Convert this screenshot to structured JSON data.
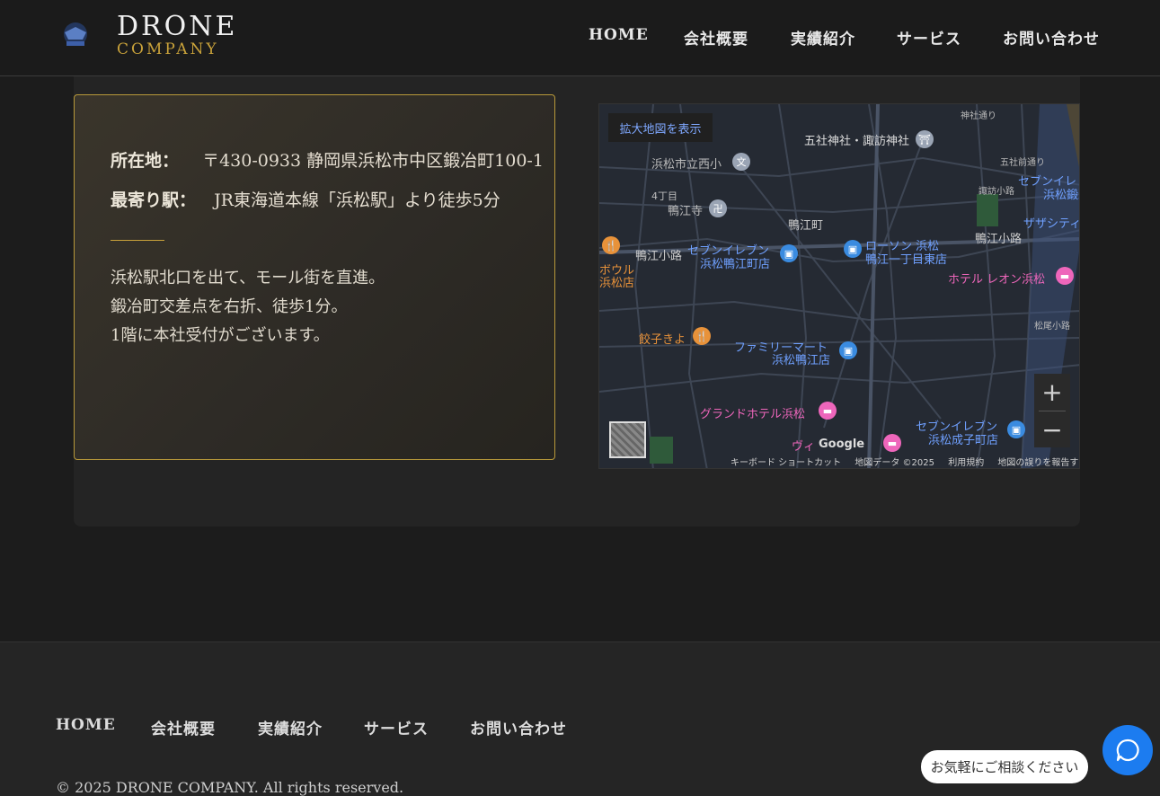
{
  "brand": {
    "title": "DRONE",
    "subtitle": "COMPANY",
    "accent": "#c9a23a"
  },
  "nav": [
    "HOME",
    "会社概要",
    "実績紹介",
    "サービス",
    "お問い合わせ"
  ],
  "access": {
    "address_label": "所在地：",
    "address_value": "〒430-0933 静岡県浜松市中区鍛冶町100-1",
    "station_label": "最寄り駅：",
    "station_value": "JR東海道本線「浜松駅」より徒歩5分",
    "directions": [
      "浜松駅北口を出て、モール街を直進。",
      "鍛冶町交差点を右折、徒歩1分。",
      "1階に本社受付がございます。"
    ]
  },
  "map": {
    "open_larger": "拡大地図を表示",
    "zoom_in": "+",
    "zoom_out": "−",
    "footer": [
      "キーボード ショートカット",
      "地図データ ©2025",
      "利用規約",
      "地図の誤りを報告する"
    ],
    "labels": [
      "五社神社・諏訪神社",
      "浜松市立西小",
      "4丁目",
      "鴨江寺",
      "鴨江町",
      "鴨江小路",
      "セブンイレブン",
      "浜松鴨江町店",
      "ローソン 浜松",
      "鴨江一丁目東店",
      "ボウル",
      "浜松店",
      "ホテル レオン浜松",
      "餃子きよ",
      "ファミリーマート",
      "浜松鴨江店",
      "グランドホテル浜松",
      "ヴィ",
      "Google",
      "セブンイレブン",
      "浜松成子町店",
      "五社前通り",
      "諏訪小路",
      "浜松鍛冶",
      "ザザシティ",
      "松尾小路",
      "鴨江小路",
      "セブンイレ",
      "神社通り"
    ]
  },
  "footer": {
    "nav": [
      "HOME",
      "会社概要",
      "実績紹介",
      "サービス",
      "お問い合わせ"
    ],
    "copyright": "© 2025 DRONE COMPANY. All rights reserved."
  },
  "chat": {
    "prompt": "お気軽にご相談ください",
    "color": "#1c7cf0"
  }
}
